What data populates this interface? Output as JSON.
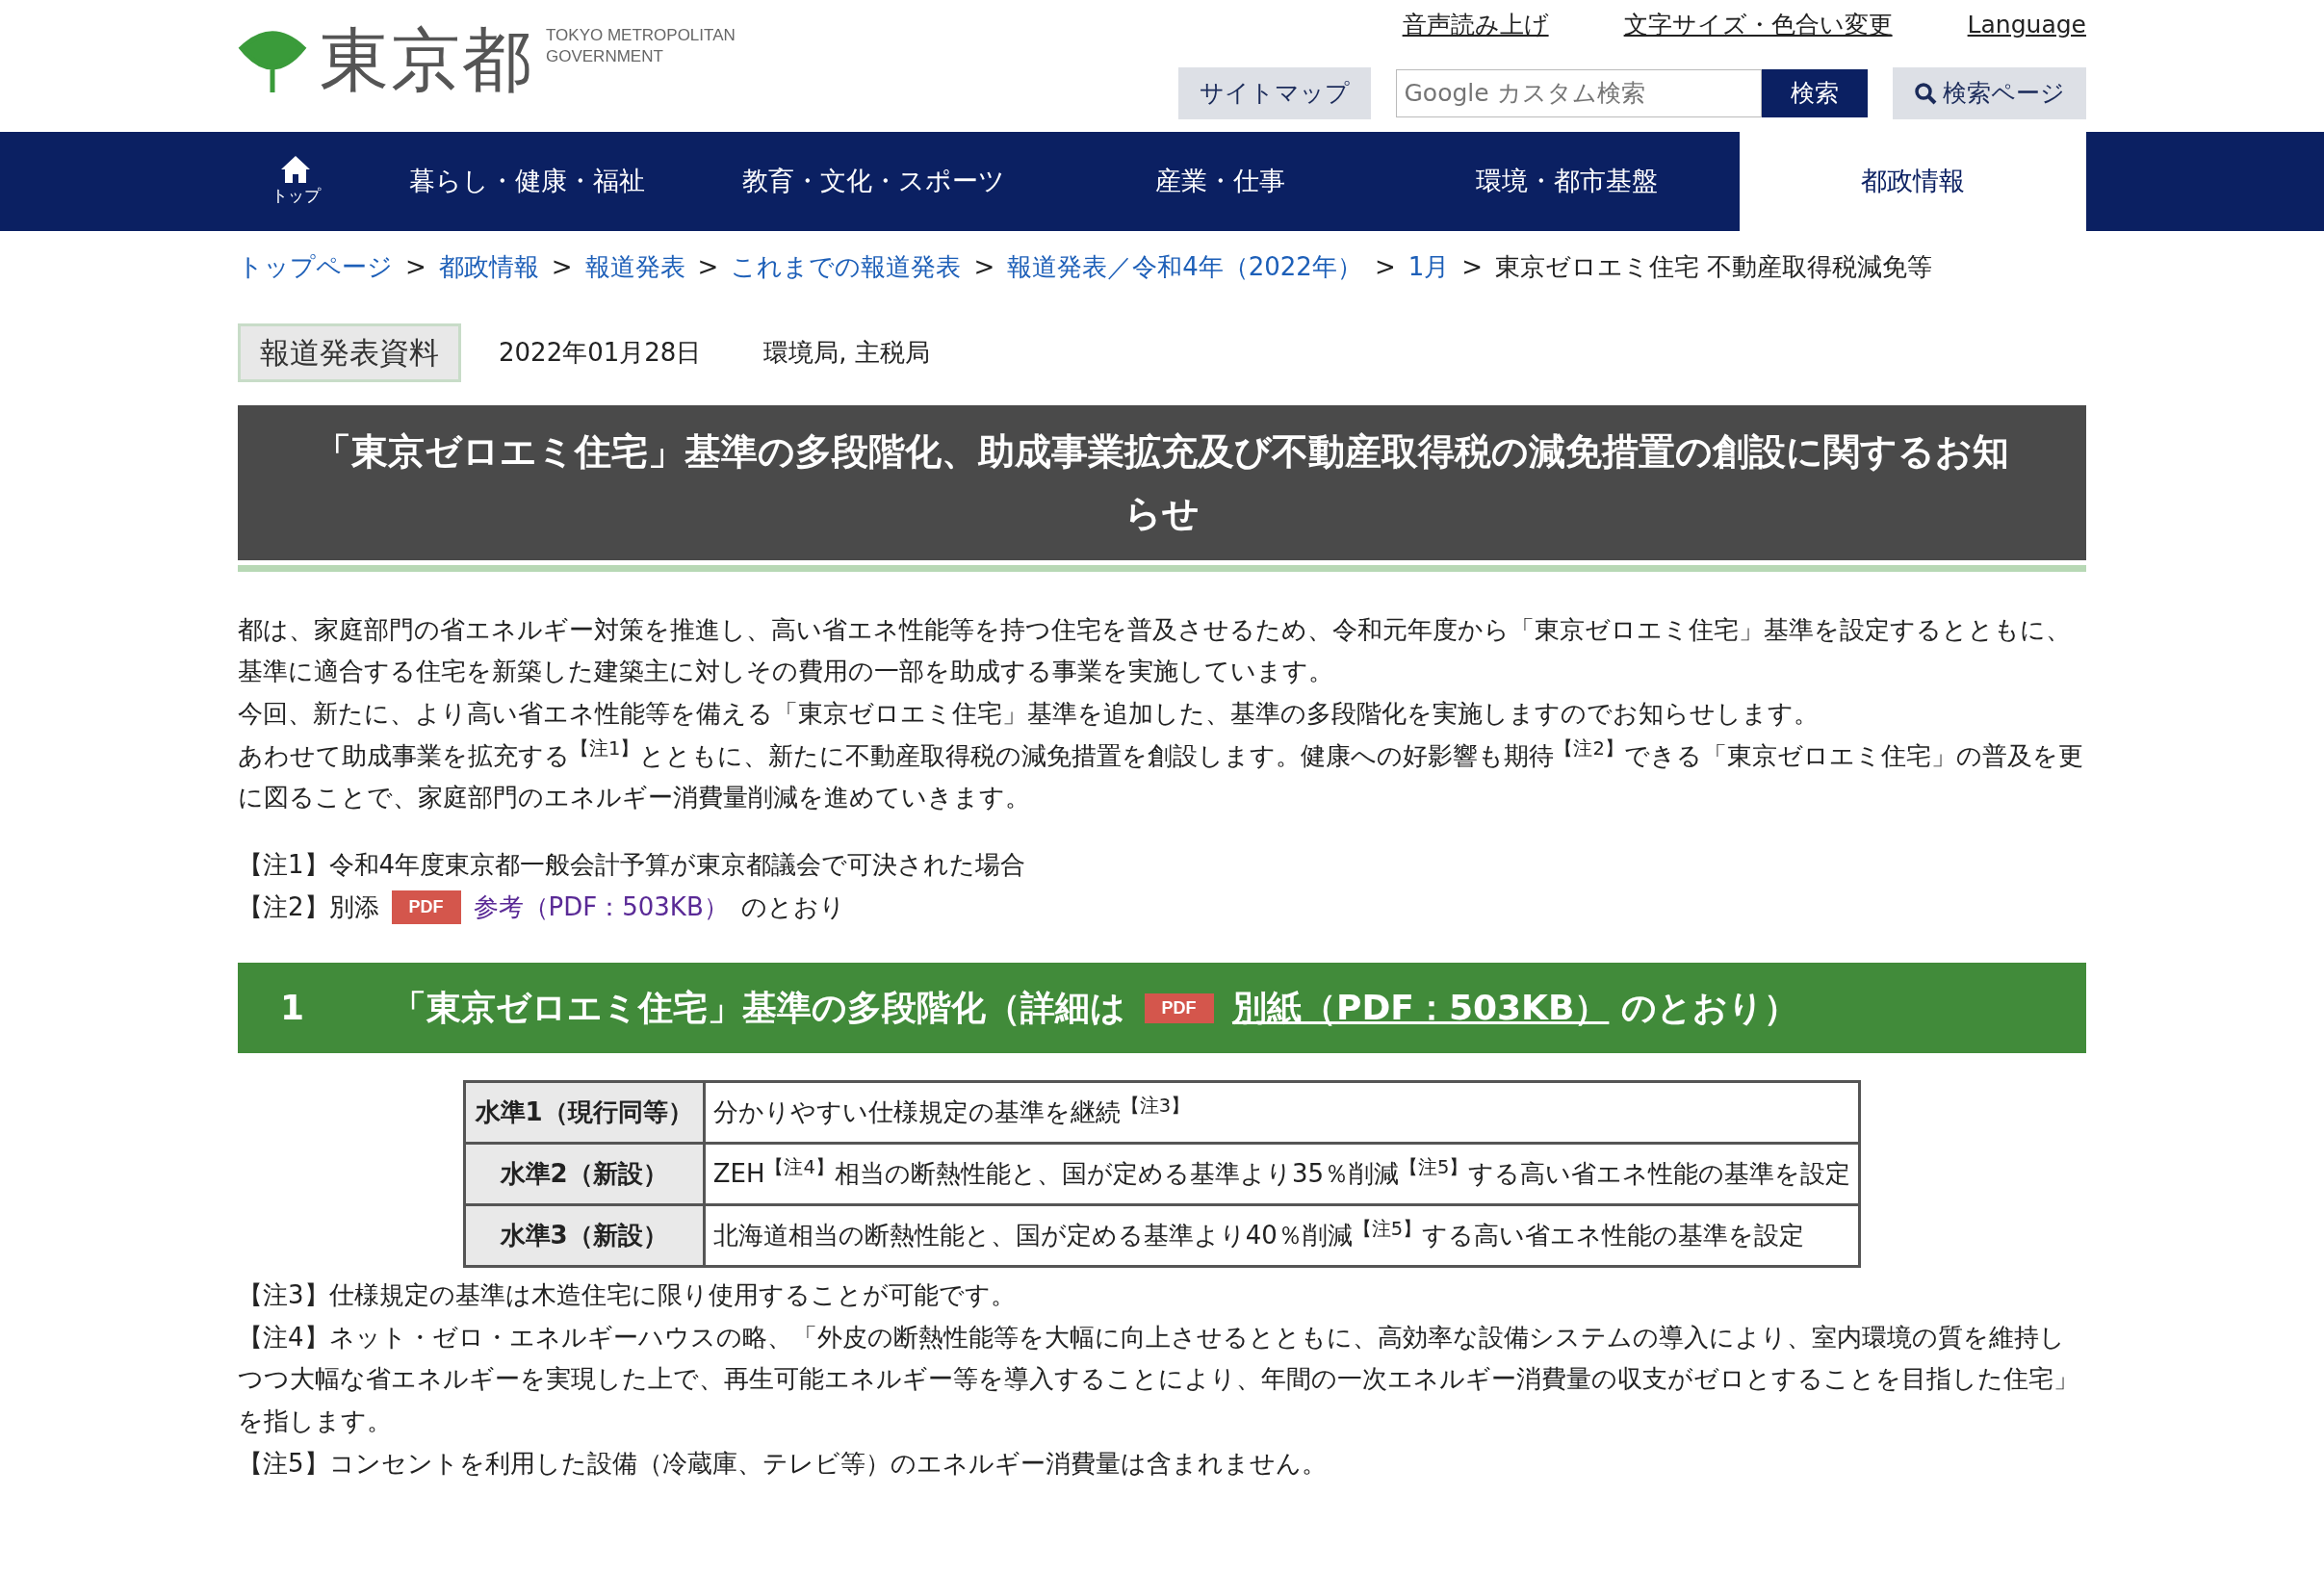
{
  "header": {
    "logo": {
      "kanji": "東京都",
      "english_lines": [
        "TOKYO METROPOLITAN",
        "GOVERNMENT"
      ]
    },
    "utility_links": [
      "音声読み上げ",
      "文字サイズ・色合い変更",
      "Language"
    ],
    "sitemap_button": "サイトマップ",
    "search": {
      "placeholder": "Google カスタム検索",
      "button": "検索"
    },
    "search_page_button": "検索ページ"
  },
  "nav": {
    "home": {
      "label": "トップ",
      "selected": false
    },
    "items": [
      {
        "label": "暮らし・健康・福祉",
        "selected": false
      },
      {
        "label": "教育・文化・スポーツ",
        "selected": false
      },
      {
        "label": "産業・仕事",
        "selected": false
      },
      {
        "label": "環境・都市基盤",
        "selected": false
      },
      {
        "label": "都政情報",
        "selected": true
      }
    ]
  },
  "breadcrumb": {
    "separator": ">",
    "items": [
      {
        "label": "トップページ",
        "link": true
      },
      {
        "label": "都政情報",
        "link": true
      },
      {
        "label": "報道発表",
        "link": true
      },
      {
        "label": "これまでの報道発表",
        "link": true
      },
      {
        "label": "報道発表／令和4年（2022年）",
        "link": true
      },
      {
        "label": "1月",
        "link": true
      },
      {
        "label": "東京ゼロエミ住宅 不動産取得税減免等",
        "link": false
      }
    ]
  },
  "release": {
    "badge": "報道発表資料",
    "date": "2022年01月28日",
    "departments": "環境局, 主税局"
  },
  "title": "「東京ゼロエミ住宅」基準の多段階化、助成事業拡充及び不動産取得税の減免措置の創設に関するお知らせ",
  "paragraphs": [
    "都は、家庭部門の省エネルギー対策を推進し、高い省エネ性能等を持つ住宅を普及させるため、令和元年度から「東京ゼロエミ住宅」基準を設定するとともに、基準に適合する住宅を新築した建築主に対しその費用の一部を助成する事業を実施しています。",
    "今回、新たに、より高い省エネ性能等を備える「東京ゼロエミ住宅」基準を追加した、基準の多段階化を実施しますのでお知らせします。",
    "あわせて助成事業を拡充する$^{【注1】}$とともに、新たに不動産取得税の減免措置を創設します。健康への好影響も期待$^{【注2】}$できる「東京ゼロエミ住宅」の普及を更に図ることで、家庭部門のエネルギー消費量削減を進めていきます。"
  ],
  "notes_top": [
    {
      "kind": "text",
      "text": "【注1】令和4年度東京都一般会計予算が東京都議会で可決された場合"
    },
    {
      "kind": "pdf",
      "prefix": "【注2】別添",
      "pdf_badge": "PDF",
      "link": "参考（PDF：503KB）",
      "suffix": "のとおり"
    }
  ],
  "section": {
    "number": "1",
    "title": "「東京ゼロエミ住宅」基準の多段階化（詳細は",
    "pdf_badge": "PDF",
    "link": "別紙（PDF：503KB）",
    "suffix": "のとおり）"
  },
  "table": {
    "rows": [
      {
        "level": "水準1（現行同等）",
        "description": "分かりやすい仕様規定の基準を継続$^{【注3】}$"
      },
      {
        "level": "水準2（新設）",
        "description": "ZEH$^{【注4】}$相当の断熱性能と、国が定める基準より35％削減$^{【注5】}$する高い省エネ性能の基準を設定"
      },
      {
        "level": "水準3（新設）",
        "description": "北海道相当の断熱性能と、国が定める基準より40％削減$^{【注5】}$する高い省エネ性能の基準を設定"
      }
    ]
  },
  "notes_bottom": [
    "【注3】仕様規定の基準は木造住宅に限り使用することが可能です。",
    "【注4】ネット・ゼロ・エネルギーハウスの略、「外皮の断熱性能等を大幅に向上させるとともに、高効率な設備システムの導入により、室内環境の質を維持しつつ大幅な省エネルギーを実現した上で、再生可能エネルギー等を導入することにより、年間の一次エネルギー消費量の収支がゼロとすることを目指した住宅」を指します。",
    "【注5】コンセントを利用した設備（冷蔵庫、テレビ等）のエネルギー消費量は含まれません。"
  ]
}
